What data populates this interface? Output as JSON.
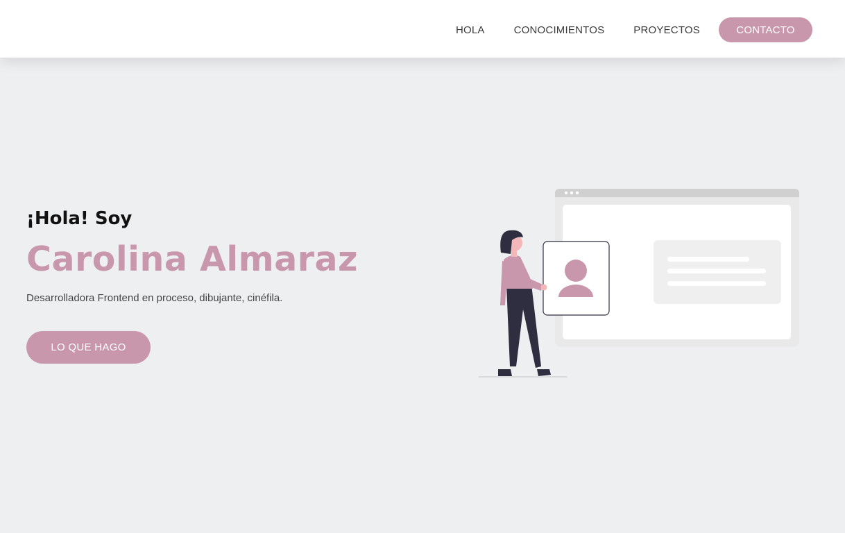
{
  "nav": {
    "items": [
      {
        "label": "HOLA"
      },
      {
        "label": "CONOCIMIENTOS"
      },
      {
        "label": "PROYECTOS"
      }
    ],
    "cta_label": "CONTACTO"
  },
  "hero": {
    "greeting": "¡Hola! Soy",
    "name": "Carolina Almaraz",
    "tagline": "Desarrolladora Frontend en proceso, dibujante, cinéfila.",
    "button_label": "LO QUE HAGO"
  },
  "colors": {
    "accent": "#c897ab",
    "background": "#eeeff1",
    "header": "#ffffff",
    "figure_dark": "#2f2e41"
  },
  "illustration": {
    "icons": [
      "profile-card-icon",
      "browser-window-icon",
      "woman-figure-icon"
    ]
  }
}
